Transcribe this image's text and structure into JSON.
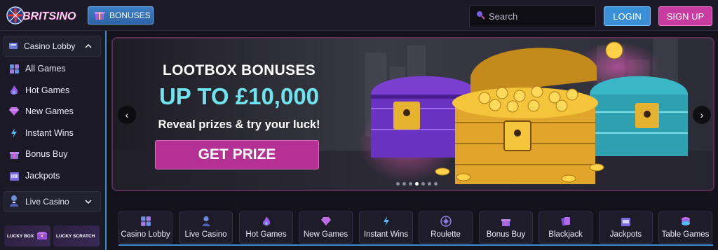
{
  "header": {
    "logo_text": "BRITSINO",
    "bonuses_label": "BONUSES",
    "search_placeholder": "Search",
    "login_label": "LOGIN",
    "signup_label": "SIGN UP"
  },
  "sidebar": {
    "casino_lobby": "Casino Lobby",
    "items": [
      {
        "label": "All Games",
        "icon": "grid-icon"
      },
      {
        "label": "Hot Games",
        "icon": "flame-icon"
      },
      {
        "label": "New Games",
        "icon": "diamond-icon"
      },
      {
        "label": "Instant Wins",
        "icon": "lightning-icon"
      },
      {
        "label": "Bonus Buy",
        "icon": "gift-icon"
      },
      {
        "label": "Jackpots",
        "icon": "slot-machine-icon"
      }
    ],
    "live_casino": "Live Casino",
    "promos": [
      "LUCKY BOX",
      "LUCKY SCRATCH"
    ]
  },
  "banner": {
    "title": "LOOTBOX BONUSES",
    "amount": "UP TO £10,000",
    "subtitle": "Reveal prizes & try your luck!",
    "cta": "GET PRIZE",
    "prev": "‹",
    "next": "›",
    "slides": 7,
    "active_slide": 4
  },
  "categories": [
    {
      "label": "Casino Lobby",
      "icon": "grid-icon"
    },
    {
      "label": "Live Casino",
      "icon": "dealer-icon"
    },
    {
      "label": "Hot Games",
      "icon": "flame-icon"
    },
    {
      "label": "New Games",
      "icon": "diamond-icon"
    },
    {
      "label": "Instant Wins",
      "icon": "lightning-icon"
    },
    {
      "label": "Roulette",
      "icon": "roulette-icon"
    },
    {
      "label": "Bonus Buy",
      "icon": "gift-icon"
    },
    {
      "label": "Blackjack",
      "icon": "cards-icon"
    },
    {
      "label": "Jackpots",
      "icon": "slot-machine-icon"
    },
    {
      "label": "Table Games",
      "icon": "chips-icon"
    }
  ],
  "colors": {
    "accent_blue": "#3b8fd8",
    "accent_pink": "#c83ba0",
    "amount_cyan": "#6fe3ee"
  }
}
